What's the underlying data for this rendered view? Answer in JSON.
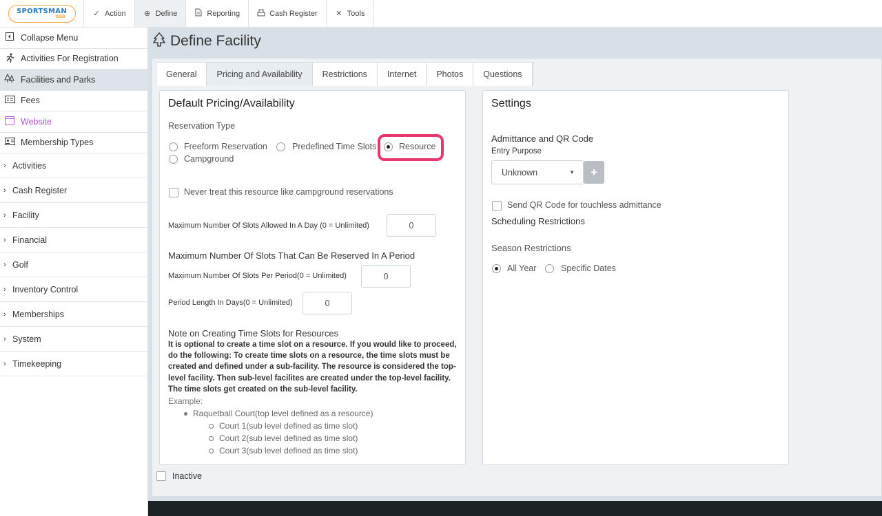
{
  "app": {
    "logo_text": "SPORTSMAN",
    "logo_sub": "WEB"
  },
  "topnav": {
    "items": [
      {
        "label": "Action",
        "icon": "check-icon"
      },
      {
        "label": "Define",
        "icon": "plus-circle-icon"
      },
      {
        "label": "Reporting",
        "icon": "document-icon"
      },
      {
        "label": "Cash Register",
        "icon": "cash-register-icon"
      },
      {
        "label": "Tools",
        "icon": "tools-icon"
      }
    ]
  },
  "sidebar": {
    "items": [
      {
        "label": "Collapse Menu",
        "icon": "collapse-icon"
      },
      {
        "label": "Activities For Registration",
        "icon": "runner-icon"
      },
      {
        "label": "Facilities and Parks",
        "icon": "trees-icon"
      },
      {
        "label": "Fees",
        "icon": "fees-icon"
      },
      {
        "label": "Website",
        "icon": "browser-icon"
      },
      {
        "label": "Membership Types",
        "icon": "id-card-icon"
      }
    ],
    "groups": [
      "Activities",
      "Cash Register",
      "Facility",
      "Financial",
      "Golf",
      "Inventory Control",
      "Memberships",
      "System",
      "Timekeeping"
    ]
  },
  "page": {
    "title": "Define Facility",
    "tabs": [
      "General",
      "Pricing and Availability",
      "Restrictions",
      "Internet",
      "Photos",
      "Questions"
    ],
    "active_tab": "Pricing and Availability"
  },
  "pricing": {
    "heading": "Default Pricing/Availability",
    "reservation_type_label": "Reservation Type",
    "options": [
      "Freeform Reservation",
      "Predefined Time Slots",
      "Resource",
      "Campground"
    ],
    "selected": "Resource",
    "never_campground_label": "Never treat this resource like campground reservations",
    "max_slots_day_label": "Maximum Number Of Slots Allowed In A Day (0 = Unlimited)",
    "max_slots_day_value": "0",
    "period_heading": "Maximum Number Of Slots That Can Be Reserved In A Period",
    "max_slots_period_label": "Maximum Number Of Slots Per Period(0 = Unlimited)",
    "max_slots_period_value": "0",
    "period_length_label": "Period Length In Days(0 = Unlimited)",
    "period_length_value": "0",
    "note_title": "Note on Creating Time Slots for Resources",
    "note_body": "It is optional to create a time slot on a resource. If you would like to proceed, do the following: To create time slots on a resource, the time slots must be created and defined under a sub-facility. The resource is considered the top-level facility. Then sub-level facilites are created under the top-level facility. The time slots get created on the sub-level facility.",
    "example_label": "Example:",
    "example_top": "Raquetball Court(top level defined as a resource)",
    "example_subs": [
      "Court 1(sub level defined as time slot)",
      "Court 2(sub level defined as time slot)",
      "Court 3(sub level defined as time slot)"
    ]
  },
  "settings": {
    "heading": "Settings",
    "admittance_heading": "Admittance and QR Code",
    "entry_purpose_label": "Entry Purpose",
    "entry_purpose_value": "Unknown",
    "plus_label": "+",
    "qr_label": "Send QR Code for touchless admittance",
    "scheduling_heading": "Scheduling Restrictions",
    "season_label": "Season Restrictions",
    "season_options": [
      "All Year",
      "Specific Dates"
    ],
    "season_selected": "All Year"
  },
  "footer": {
    "inactive_label": "Inactive"
  },
  "colors": {
    "highlight": "#e8376d",
    "website_link": "#b155d6",
    "page_bg": "#d7e0e6"
  }
}
